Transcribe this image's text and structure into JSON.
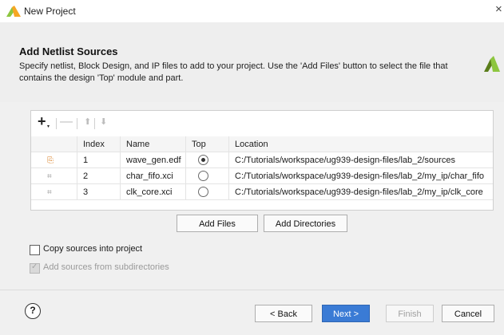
{
  "window": {
    "title": "New Project",
    "close_glyph": "×"
  },
  "header": {
    "heading": "Add Netlist Sources",
    "description": "Specify netlist, Block Design, and IP files to add to your project. Use the 'Add Files' button to select the file that contains the design 'Top' module and part."
  },
  "toolbar": {
    "add_glyph": "+",
    "add_sub_glyph": "▾",
    "remove_glyph": "—",
    "move_up_glyph": "⬆",
    "move_down_glyph": "⬇"
  },
  "table": {
    "columns": [
      "",
      "Index",
      "Name",
      "Top",
      "Location"
    ],
    "rows": [
      {
        "icon": "netlist-file-icon",
        "icon_glyph": "⎘",
        "index": "1",
        "name": "wave_gen.edf",
        "top": true,
        "location": "C:/Tutorials/workspace/ug939-design-files/lab_2/sources"
      },
      {
        "icon": "ip-chip-icon",
        "icon_glyph": "⌗",
        "index": "2",
        "name": "char_fifo.xci",
        "top": false,
        "location": "C:/Tutorials/workspace/ug939-design-files/lab_2/my_ip/char_fifo"
      },
      {
        "icon": "ip-chip-icon",
        "icon_glyph": "⌗",
        "index": "3",
        "name": "clk_core.xci",
        "top": false,
        "location": "C:/Tutorials/workspace/ug939-design-files/lab_2/my_ip/clk_core"
      }
    ]
  },
  "actions": {
    "add_files": "Add Files",
    "add_directories": "Add Directories"
  },
  "options": {
    "copy_sources": {
      "label": "Copy sources into project",
      "checked": false,
      "enabled": true
    },
    "add_subdirs": {
      "label": "Add sources from subdirectories",
      "checked": true,
      "enabled": false
    }
  },
  "footer": {
    "help": "?",
    "back": "< Back",
    "next": "Next >",
    "finish": "Finish",
    "cancel": "Cancel"
  },
  "colors": {
    "next_button": "#3a7bd5",
    "logo_accent": "#8dc63f",
    "logo_dark": "#5a7d1a"
  }
}
